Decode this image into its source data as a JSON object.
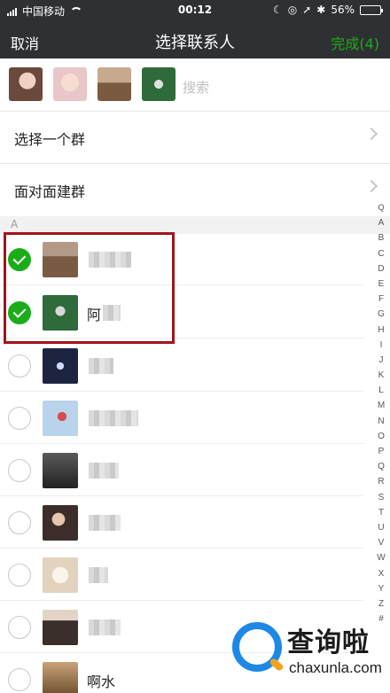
{
  "status_bar": {
    "carrier": "中国移动",
    "time": "00:12",
    "battery_percent": "56%",
    "battery_level": 0.56
  },
  "nav": {
    "cancel_label": "取消",
    "title": "选择联系人",
    "done_label": "完成(4)",
    "done_color": "#1aad19"
  },
  "selected_bar": {
    "avatars": [
      "avatar-selected-1",
      "avatar-selected-2",
      "avatar-selected-3",
      "avatar-selected-4"
    ],
    "search_placeholder": "搜索"
  },
  "menu": [
    {
      "label": "选择一个群"
    },
    {
      "label": "面对面建群"
    }
  ],
  "section_letter": "A",
  "contacts": [
    {
      "checked": true,
      "name": "",
      "avatar_color": "#8a6b55"
    },
    {
      "checked": true,
      "name": "阿",
      "avatar_color": "#2f6b3a"
    },
    {
      "checked": false,
      "name": "",
      "avatar_color": "#1c2440"
    },
    {
      "checked": false,
      "name": "",
      "avatar_color": "#a9c7e0"
    },
    {
      "checked": false,
      "name": "",
      "avatar_color": "#3a3a3a"
    },
    {
      "checked": false,
      "name": "",
      "avatar_color": "#5b4b48"
    },
    {
      "checked": false,
      "name": "",
      "avatar_color": "#e8dccc"
    },
    {
      "checked": false,
      "name": "",
      "avatar_color": "#6d5c52"
    },
    {
      "checked": false,
      "name": "啊水",
      "avatar_color": "#8a6a3a"
    }
  ],
  "index_letters": [
    "Q",
    "A",
    "B",
    "C",
    "D",
    "E",
    "F",
    "G",
    "H",
    "I",
    "J",
    "K",
    "L",
    "M",
    "N",
    "O",
    "P",
    "Q",
    "R",
    "S",
    "T",
    "U",
    "V",
    "W",
    "X",
    "Y",
    "Z",
    "#"
  ],
  "watermark": {
    "brand": "查询啦",
    "domain": "chaxunla.com"
  },
  "colors": {
    "nav_bg": "#2f3033",
    "check_green": "#1aad19",
    "highlight_red": "#a1141c"
  }
}
